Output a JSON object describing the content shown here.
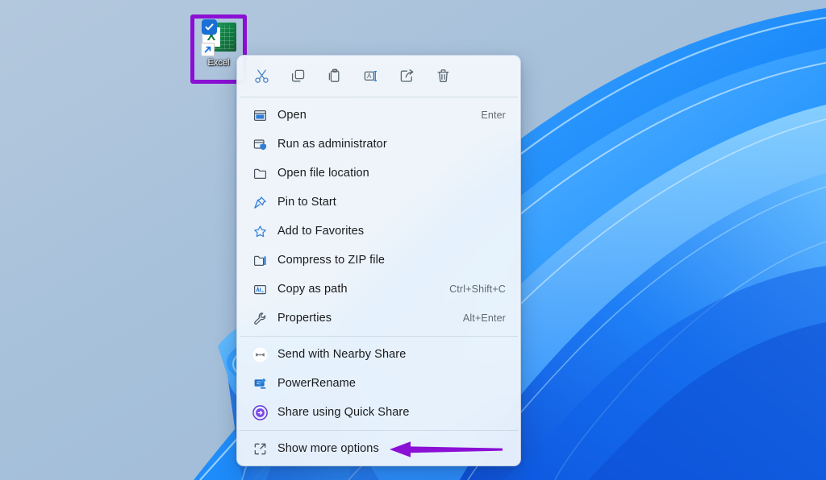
{
  "desktop": {
    "wallpaper_name": "windows-11-bloom-wallpaper",
    "background_color": "#a9c2da",
    "accent_blue": "#1a8cff",
    "deep_blue": "#0a4de0",
    "icon": {
      "label": "Excel",
      "icon_name": "excel-shortcut-icon",
      "badge_icon": "onedrive-sync-check-badge",
      "overlay_icon": "shortcut-arrow-overlay",
      "highlight_color": "#8b0fd4",
      "tile_color": "#107c41",
      "letter": "X"
    }
  },
  "context_menu": {
    "toolbar": [
      {
        "name": "cut-button",
        "icon": "scissors-icon",
        "tooltip": "Cut"
      },
      {
        "name": "copy-button",
        "icon": "copy-icon",
        "tooltip": "Copy"
      },
      {
        "name": "paste-button",
        "icon": "paste-icon",
        "tooltip": "Paste"
      },
      {
        "name": "rename-button",
        "icon": "rename-icon",
        "tooltip": "Rename"
      },
      {
        "name": "share-button",
        "icon": "share-icon",
        "tooltip": "Share"
      },
      {
        "name": "delete-button",
        "icon": "trash-icon",
        "tooltip": "Delete"
      }
    ],
    "groups": [
      {
        "items": [
          {
            "label": "Open",
            "accel": "Enter",
            "icon": "open-window-icon"
          },
          {
            "label": "Run as administrator",
            "accel": "",
            "icon": "shield-window-icon"
          },
          {
            "label": "Open file location",
            "accel": "",
            "icon": "folder-icon"
          },
          {
            "label": "Pin to Start",
            "accel": "",
            "icon": "pin-icon"
          },
          {
            "label": "Add to Favorites",
            "accel": "",
            "icon": "star-icon"
          },
          {
            "label": "Compress to ZIP file",
            "accel": "",
            "icon": "zip-folder-icon"
          },
          {
            "label": "Copy as path",
            "accel": "Ctrl+Shift+C",
            "icon": "copy-path-icon"
          },
          {
            "label": "Properties",
            "accel": "Alt+Enter",
            "icon": "wrench-icon"
          }
        ]
      },
      {
        "items": [
          {
            "label": "Send with Nearby Share",
            "accel": "",
            "icon": "nearby-share-icon"
          },
          {
            "label": "PowerRename",
            "accel": "",
            "icon": "powerrename-icon"
          },
          {
            "label": "Share using Quick Share",
            "accel": "",
            "icon": "quick-share-icon"
          }
        ]
      },
      {
        "items": [
          {
            "label": "Show more options",
            "accel": "",
            "icon": "show-more-options-icon"
          }
        ]
      }
    ]
  },
  "annotation": {
    "arrow_name": "purple-pointer-arrow",
    "arrow_color": "#8b0fd4",
    "points_to": "Show more options"
  }
}
